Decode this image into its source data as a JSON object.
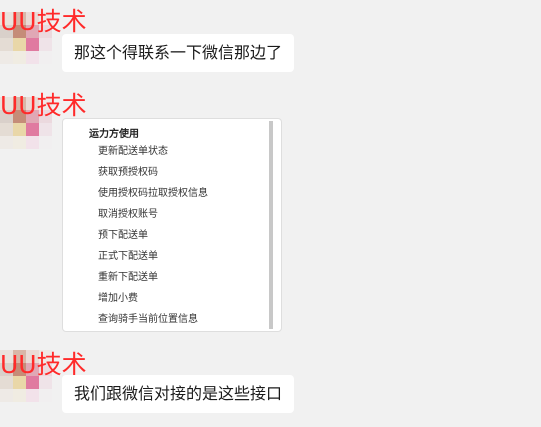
{
  "watermark": "UU技术",
  "messages": [
    {
      "type": "text",
      "text": "那这个得联系一下微信那边了"
    },
    {
      "type": "image",
      "menu": {
        "title": "运力方使用",
        "items": [
          "更新配送单状态",
          "获取预授权码",
          "使用授权码拉取授权信息",
          "取消授权账号",
          "预下配送单",
          "正式下配送单",
          "重新下配送单",
          "增加小费",
          "查询骑手当前位置信息"
        ]
      }
    },
    {
      "type": "text",
      "text": "我们跟微信对接的是这些接口"
    }
  ]
}
